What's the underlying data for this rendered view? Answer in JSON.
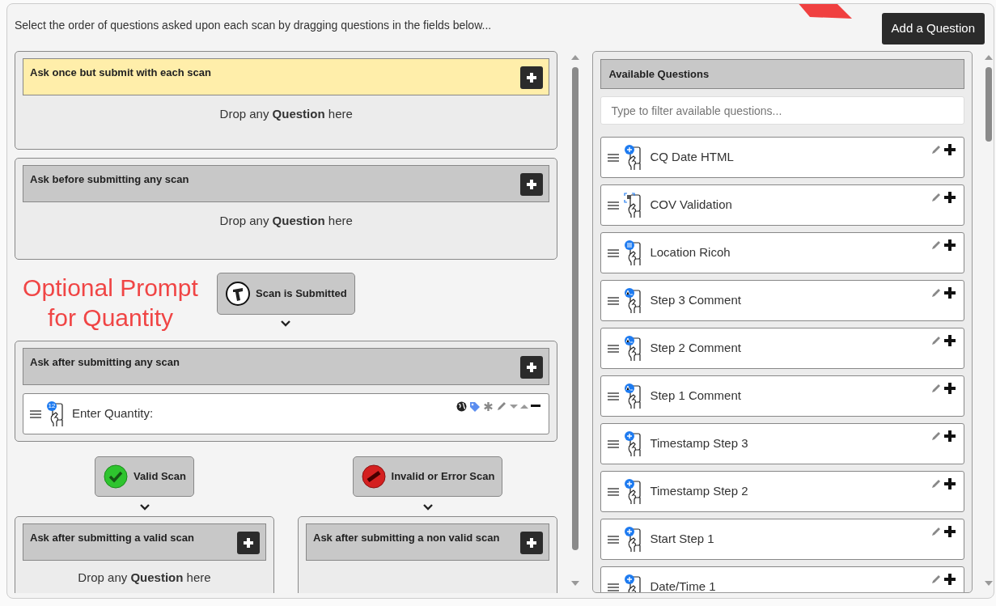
{
  "instruction": "Select the order of questions asked upon each scan by dragging questions in the fields below...",
  "add_button": "Add a Question",
  "top_sections": [
    {
      "title": "Ask once but submit with each scan",
      "highlighted": true,
      "drop_text": "Drop any **Question** here"
    },
    {
      "title": "Ask before submitting any scan",
      "highlighted": false,
      "drop_text": "Drop any **Question** here"
    }
  ],
  "annotation": "Optional Prompt for Quantity",
  "trigger": {
    "label": "Scan is Submitted"
  },
  "after_section": {
    "title": "Ask after submitting any scan",
    "questions": [
      {
        "label": "Enter Quantity:",
        "badge": "12"
      }
    ]
  },
  "branches": [
    {
      "kind": "valid",
      "trigger": "Valid Scan",
      "title": "Ask after submitting a valid scan",
      "drop_text": "Drop any **Question** here"
    },
    {
      "kind": "invalid",
      "trigger": "Invalid or Error Scan",
      "title": "Ask after submitting a non valid scan"
    }
  ],
  "available": {
    "title": "Available Questions",
    "filter_placeholder": "Type to filter available questions...",
    "questions": [
      {
        "label": "CQ Date HTML",
        "kind": "plus"
      },
      {
        "label": "COV Validation",
        "kind": "scan"
      },
      {
        "label": "Location Ricoh",
        "kind": "list"
      },
      {
        "label": "Step 3 Comment",
        "kind": "text"
      },
      {
        "label": "Step 2 Comment",
        "kind": "text"
      },
      {
        "label": "Step 1 Comment",
        "kind": "text"
      },
      {
        "label": "Timestamp Step 3",
        "kind": "plus"
      },
      {
        "label": "Timestamp Step 2",
        "kind": "plus"
      },
      {
        "label": "Start Step 1",
        "kind": "plus"
      },
      {
        "label": "Date/Time 1",
        "kind": "plus"
      }
    ]
  }
}
